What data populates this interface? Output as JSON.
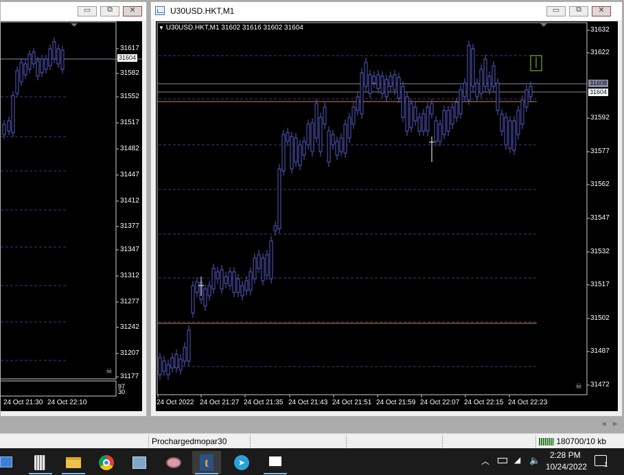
{
  "left_window": {
    "controls": {
      "minimize": "▭",
      "restore": "⧉",
      "close": "✕"
    },
    "price_axis": [
      "31617",
      "31582",
      "31552",
      "31517",
      "31482",
      "31447",
      "31412",
      "31377",
      "31347",
      "31312",
      "31277",
      "31242",
      "31207",
      "31177"
    ],
    "current_price": "31604",
    "time_axis": [
      "24 Oct 21:30",
      "24 Oct 22:10"
    ],
    "indicator_values": [
      "97",
      "30"
    ]
  },
  "right_window": {
    "title": "U30USD.HKT,M1",
    "controls": {
      "minimize": "▭",
      "restore": "⧉",
      "close": "✕"
    },
    "chart_header": "U30USD.HKT,M1  31602 31616 31602 31604",
    "price_axis": [
      "31632",
      "31622",
      "31592",
      "31577",
      "31562",
      "31547",
      "31532",
      "31517",
      "31502",
      "31487",
      "31472"
    ],
    "bid_price": "31608",
    "ask_price": "31604",
    "time_axis": [
      "24 Oct 2022",
      "24 Oct 21:27",
      "24 Oct 21:35",
      "24 Oct 21:43",
      "24 Oct 21:51",
      "24 Oct 21:59",
      "24 Oct 22:07",
      "24 Oct 22:15",
      "24 Oct 22:23"
    ]
  },
  "statusbar": {
    "profile": "Prochargedmopar30",
    "traffic": "180700/10 kb"
  },
  "taskbar": {
    "apps": [
      "windows-explorer-icon",
      "calculator-icon",
      "file-explorer-icon",
      "chrome-icon",
      "network-icon",
      "paint-icon",
      "mt4-icon",
      "telegram-icon",
      "notes-icon"
    ],
    "time": "2:28 PM",
    "date": "10/24/2022",
    "notification_count": "1"
  },
  "colors": {
    "chart_bg": "#000000",
    "candle": "#5a5ac8",
    "grid": "#3c3c7a",
    "orange_line": "#d08a4a",
    "price_line": "#8a8aa8"
  }
}
